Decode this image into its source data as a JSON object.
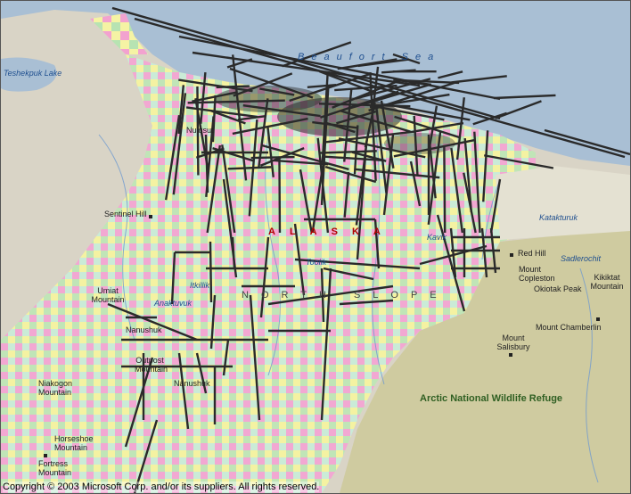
{
  "map": {
    "water_labels": {
      "sea": "Beaufort Sea",
      "lake": "Teshekpuk Lake"
    },
    "region_labels": {
      "state": "ALASKA",
      "slope": "NORTH SLOPE",
      "refuge": "Arctic National Wildlife Refuge"
    },
    "places": {
      "nuiqsut": "Nuiqsut",
      "sentinel_hill": "Sentinel Hill",
      "umiat_mountain": "Umiat Mountain",
      "anaktuvuk": "Anaktuvuk",
      "itkillik": "Itkillik",
      "toolik": "Toolik",
      "kavik": "Kavik",
      "nanushuk": "Nanushuk",
      "outpost_mountain": "Outpost Mountain",
      "nanushuk_2": "Nanushuk",
      "niakogon_mountain": "Niakogon Mountain",
      "horseshoe_mountain": "Horseshoe Mountain",
      "fortress_mountain": "Fortress Mountain",
      "katakturuk": "Katakturuk",
      "red_hill": "Red Hill",
      "mount_copleston": "Mount Copleston",
      "sadlerochit": "Sadlerochit",
      "kikiktat_mountain": "Kikiktat Mountain",
      "okiotak_peak": "Okiotak Peak",
      "mount_chamberlin": "Mount Chamberlin",
      "mount_salisbury": "Mount Salisbury"
    },
    "copyright": "Copyright © 2003 Microsoft Corp. and/or its suppliers. All rights reserved.",
    "colors": {
      "ocean": "#a9bfd4",
      "land": "#d9d4c6",
      "mountains": "#cfcba0",
      "grid_pink": "#f19fd0",
      "grid_yellow": "#f4f49a",
      "grid_green": "#b8e8b0",
      "lines": "#2a2a2a"
    }
  }
}
